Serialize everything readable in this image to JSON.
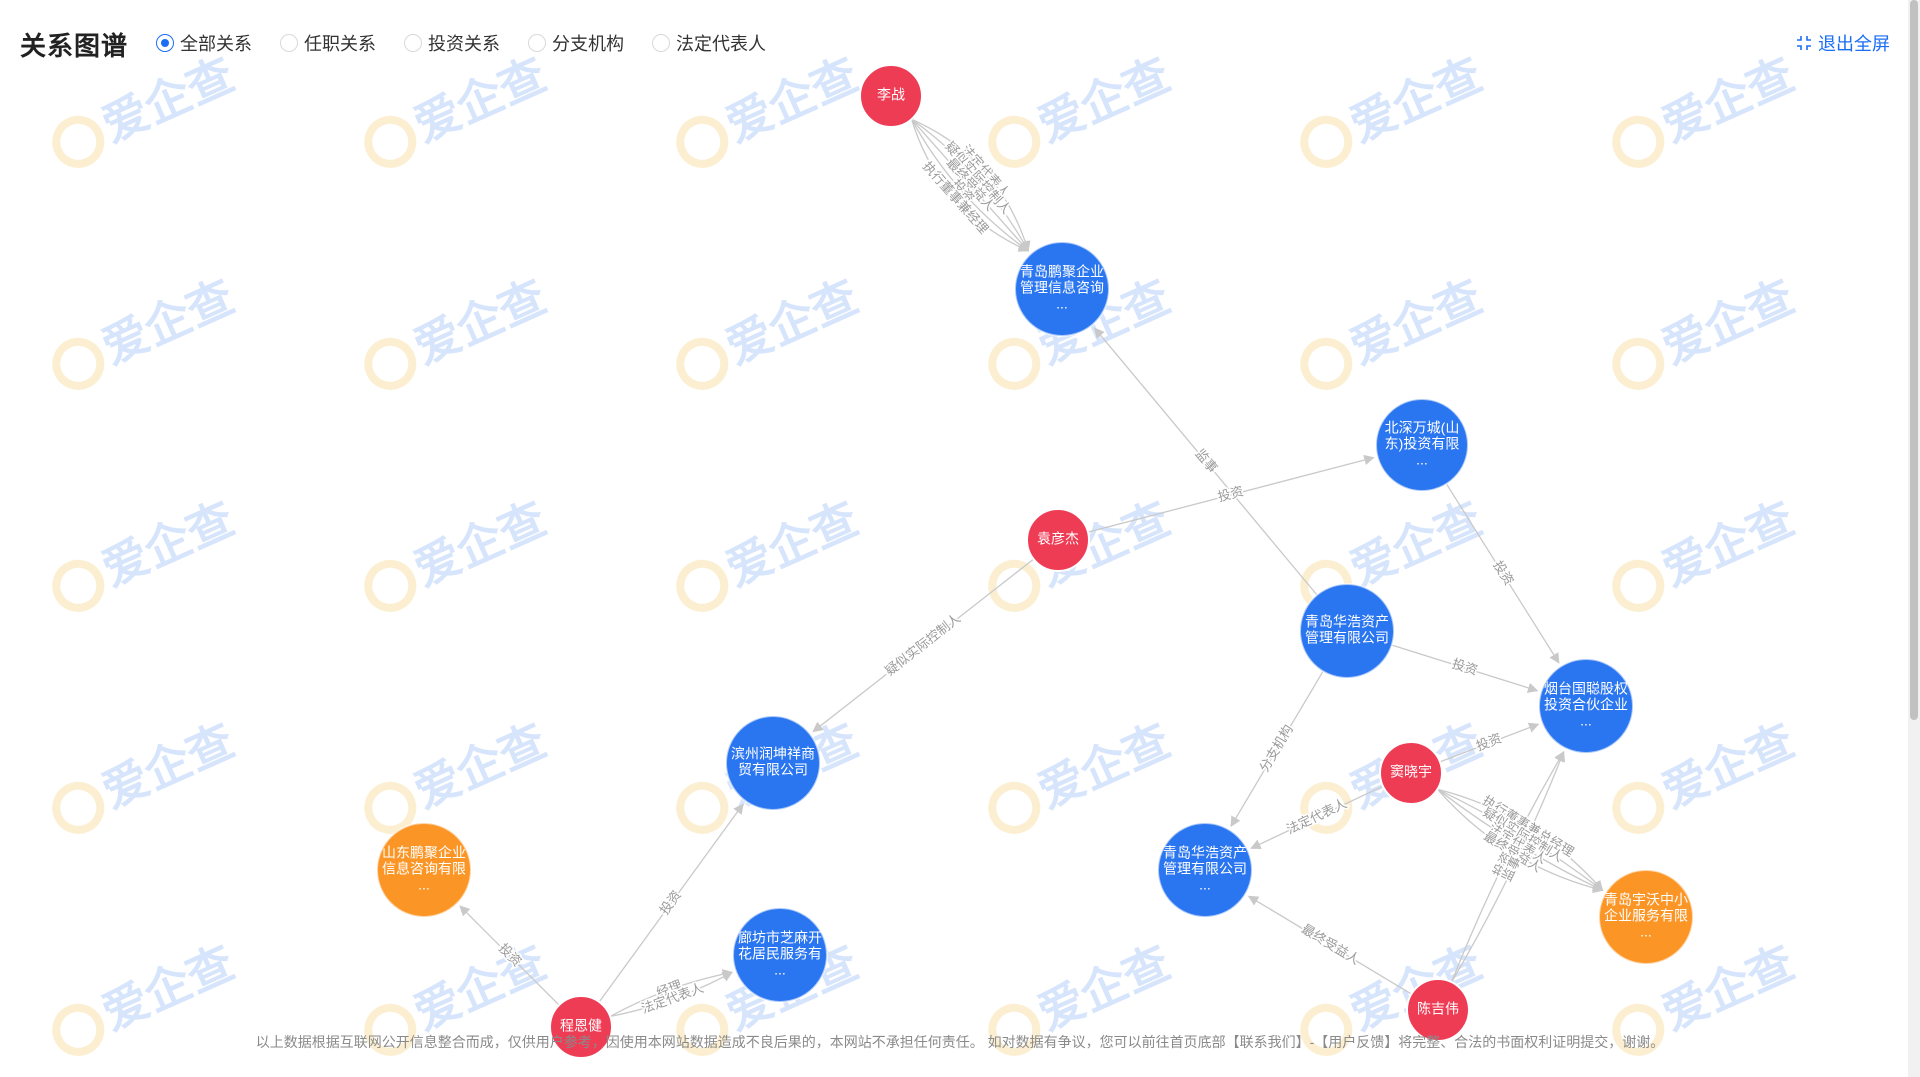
{
  "header": {
    "title": "关系图谱",
    "filters": [
      {
        "label": "全部关系",
        "checked": true
      },
      {
        "label": "任职关系",
        "checked": false
      },
      {
        "label": "投资关系",
        "checked": false
      },
      {
        "label": "分支机构",
        "checked": false
      },
      {
        "label": "法定代表人",
        "checked": false
      }
    ],
    "exit_label": "退出全屏",
    "exit_icon": "fullscreen-exit-icon"
  },
  "watermark": "爱企查",
  "colors": {
    "person": "#ef3c55",
    "company": "#2a75f0",
    "org": "#fb9626",
    "edge": "#c9c9c9",
    "edge_label": "#9a9a9a",
    "accent": "#1a6ef5"
  },
  "graph": {
    "nodes": [
      {
        "id": "lizhan",
        "type": "person",
        "label": "李战"
      },
      {
        "id": "qdpj",
        "type": "company",
        "label": "青岛鹏聚企业管理信息咨询..."
      },
      {
        "id": "bswy",
        "type": "company",
        "label": "北深万城(山东)投资有限..."
      },
      {
        "id": "yuanyanjie",
        "type": "person",
        "label": "袁彦杰"
      },
      {
        "id": "qdhh1",
        "type": "company",
        "label": "青岛华浩资产管理有限公司"
      },
      {
        "id": "ytgl",
        "type": "company",
        "label": "烟台国聪股权投资合伙企业..."
      },
      {
        "id": "bzrk",
        "type": "company",
        "label": "滨州润坤祥商贸有限公司"
      },
      {
        "id": "douxiaoyu",
        "type": "person",
        "label": "窦晓宇"
      },
      {
        "id": "sdpj",
        "type": "org",
        "label": "山东鹏聚企业信息咨询有限..."
      },
      {
        "id": "qdhh2",
        "type": "company",
        "label": "青岛华浩资产管理有限公司..."
      },
      {
        "id": "qdyw",
        "type": "org",
        "label": "青岛宇沃中小企业服务有限..."
      },
      {
        "id": "lfzm",
        "type": "company",
        "label": "廊坊市芝麻开花居民服务有..."
      },
      {
        "id": "chengenjian",
        "type": "person",
        "label": "程恩健"
      },
      {
        "id": "chenjiwei",
        "type": "person",
        "label": "陈吉伟"
      }
    ],
    "edges": [
      {
        "from": "lizhan",
        "to": "qdpj",
        "label": "法定代表人"
      },
      {
        "from": "lizhan",
        "to": "qdpj",
        "label": "疑似实际控制人"
      },
      {
        "from": "lizhan",
        "to": "qdpj",
        "label": "最终受益人"
      },
      {
        "from": "lizhan",
        "to": "qdpj",
        "label": "投资"
      },
      {
        "from": "lizhan",
        "to": "qdpj",
        "label": "执行董事兼经理"
      },
      {
        "from": "yuanyanjie",
        "to": "bswy",
        "label": "投资"
      },
      {
        "from": "qdhh1",
        "to": "qdpj",
        "label": "监事"
      },
      {
        "from": "bswy",
        "to": "ytgl",
        "label": "投资"
      },
      {
        "from": "qdhh1",
        "to": "ytgl",
        "label": "投资"
      },
      {
        "from": "yuanyanjie",
        "to": "bzrk",
        "label": "疑似实际控制人"
      },
      {
        "from": "qdhh1",
        "to": "qdhh2",
        "label": "分支机构"
      },
      {
        "from": "douxiaoyu",
        "to": "qdhh2",
        "label": "法定代表人"
      },
      {
        "from": "douxiaoyu",
        "to": "qdyw",
        "label": "执行董事兼总经理"
      },
      {
        "from": "douxiaoyu",
        "to": "qdyw",
        "label": "疑似实际控制人"
      },
      {
        "from": "douxiaoyu",
        "to": "qdyw",
        "label": "法定代表人"
      },
      {
        "from": "douxiaoyu",
        "to": "qdyw",
        "label": "最终受益人"
      },
      {
        "from": "douxiaoyu",
        "to": "ytgl",
        "label": "投资"
      },
      {
        "from": "chenjiwei",
        "to": "qdhh2",
        "label": "最终受益人"
      },
      {
        "from": "chenjiwei",
        "to": "ytgl",
        "label": "投资"
      },
      {
        "from": "chenjiwei",
        "to": "ytgl",
        "label": "监事"
      },
      {
        "from": "chengenjian",
        "to": "bzrk",
        "label": "投资"
      },
      {
        "from": "chengenjian",
        "to": "sdpj",
        "label": "投资"
      },
      {
        "from": "chengenjian",
        "to": "lfzm",
        "label": "经理"
      },
      {
        "from": "chengenjian",
        "to": "lfzm",
        "label": "法定代表人"
      }
    ]
  },
  "footer": "以上数据根据互联网公开信息整合而成，仅供用户参考，因使用本网站数据造成不良后果的，本网站不承担任何责任。 如对数据有争议，您可以前往首页底部【联系我们】-【用户反馈】将完整、合法的书面权利证明提交，谢谢。"
}
